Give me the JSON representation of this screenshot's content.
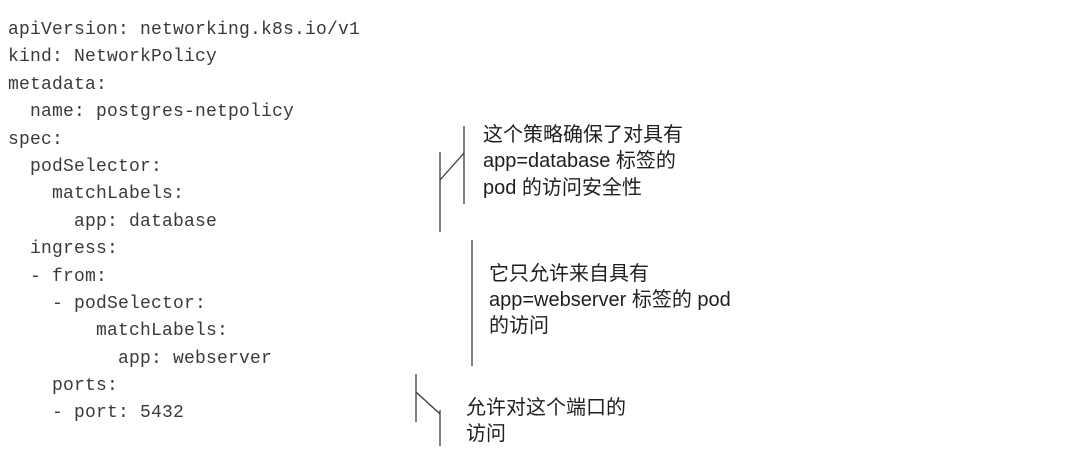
{
  "code": {
    "lines": [
      "apiVersion: networking.k8s.io/v1",
      "kind: NetworkPolicy",
      "metadata:",
      "  name: postgres-netpolicy",
      "spec:",
      "  podSelector:",
      "    matchLabels:",
      "      app: database",
      "  ingress:",
      "  - from:",
      "    - podSelector:",
      "        matchLabels:",
      "          app: webserver",
      "    ports:",
      "    - port: 5432"
    ]
  },
  "annotations": [
    {
      "lines": [
        "这个策略确保了对具有",
        "app=database 标签的",
        "pod 的访问安全性"
      ]
    },
    {
      "lines": [
        "它只允许来自具有",
        "app=webserver 标签的 pod",
        "的访问"
      ]
    },
    {
      "lines": [
        "允许对这个端口的",
        "访问"
      ]
    }
  ]
}
